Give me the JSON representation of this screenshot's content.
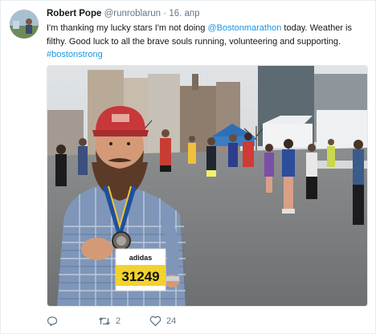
{
  "tweet": {
    "author_name": "Robert Pope",
    "author_handle": "@runroblarun",
    "separator": "·",
    "timestamp": "16. апр",
    "text_part1": "I'm thanking my lucky stars I'm not doing ",
    "mention": "@Bostonmarathon",
    "text_part2": " today. Weather is filthy. Good luck to all the brave souls running, volunteering and supporting.",
    "hashtag": "#bostonstrong",
    "bib_number": "31249",
    "bib_brand": "adidas",
    "actions": {
      "reply_icon": "reply-icon",
      "retweet_icon": "retweet-icon",
      "retweet_count": "2",
      "like_icon": "heart-icon",
      "like_count": "24"
    },
    "colors": {
      "link": "#1b95e0",
      "text": "#14171a",
      "secondary": "#657786"
    }
  }
}
